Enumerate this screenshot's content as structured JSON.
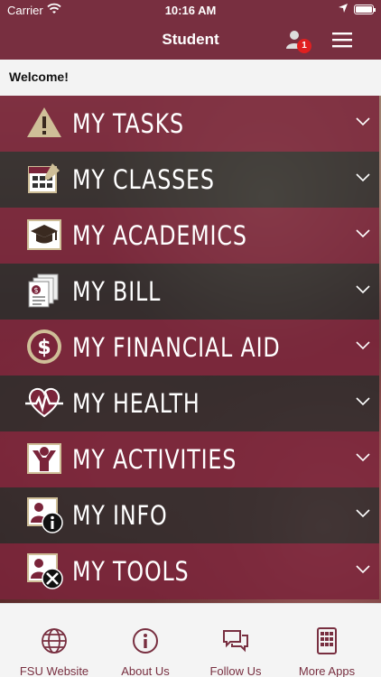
{
  "status_bar": {
    "carrier": "Carrier",
    "time": "10:16 AM"
  },
  "nav": {
    "title": "Student",
    "notification_count": "1"
  },
  "welcome": "Welcome!",
  "menu": [
    {
      "label": "MY TASKS",
      "icon": "warning-icon"
    },
    {
      "label": "MY CLASSES",
      "icon": "calendar-icon"
    },
    {
      "label": "MY ACADEMICS",
      "icon": "graduation-cap-icon"
    },
    {
      "label": "MY BILL",
      "icon": "bill-icon"
    },
    {
      "label": "MY FINANCIAL AID",
      "icon": "dollar-icon"
    },
    {
      "label": "MY HEALTH",
      "icon": "heartbeat-icon"
    },
    {
      "label": "MY ACTIVITIES",
      "icon": "activity-person-icon"
    },
    {
      "label": "MY INFO",
      "icon": "info-person-icon"
    },
    {
      "label": "MY TOOLS",
      "icon": "tools-person-icon"
    }
  ],
  "tabs": [
    {
      "label": "FSU Website",
      "icon": "globe-icon"
    },
    {
      "label": "About Us",
      "icon": "info-icon"
    },
    {
      "label": "Follow Us",
      "icon": "chat-icon"
    },
    {
      "label": "More Apps",
      "icon": "apps-grid-icon"
    }
  ],
  "colors": {
    "brand": "#782f40",
    "gold": "#cfbf98",
    "badge": "#e02020"
  }
}
